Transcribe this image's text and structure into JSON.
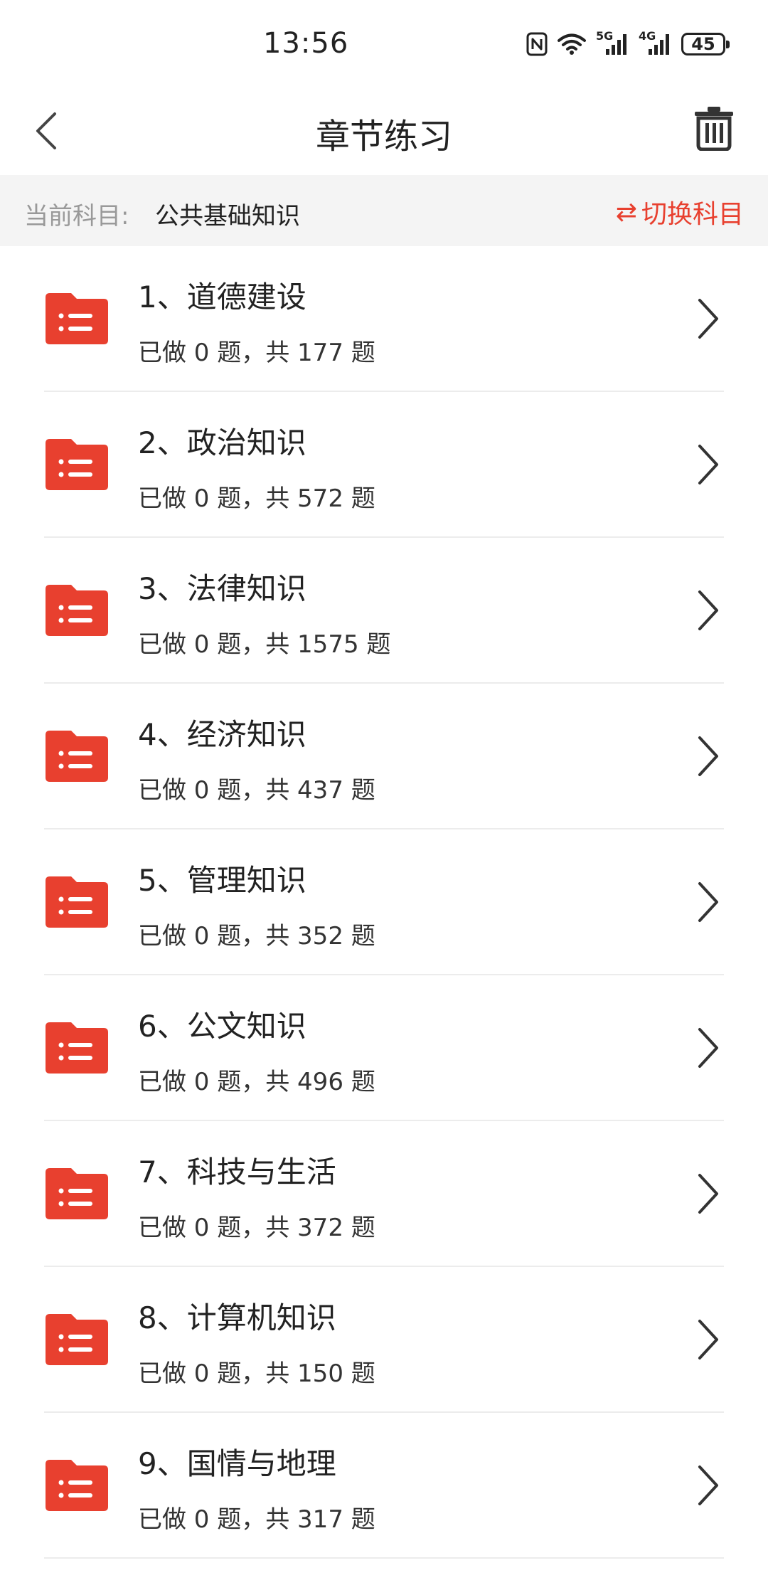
{
  "status_bar": {
    "time": "13:56",
    "battery": "45",
    "net1": "5G",
    "net2": "4G"
  },
  "header": {
    "title": "章节练习",
    "back_icon": "chevron-left-icon",
    "trash_icon": "trash-icon"
  },
  "subject": {
    "label": "当前科目:",
    "value": "公共基础知识",
    "switch_icon": "⇄",
    "switch_label": "切换科目"
  },
  "colors": {
    "accent": "#e8402f",
    "folder": "#e8402f"
  },
  "chapters": [
    {
      "title": "1、道德建设",
      "done_prefix": "已做 0 题，共 177 题"
    },
    {
      "title": "2、政治知识",
      "done_prefix": "已做 0 题，共 572 题"
    },
    {
      "title": "3、法律知识",
      "done_prefix": "已做 0 题，共 1575 题"
    },
    {
      "title": "4、经济知识",
      "done_prefix": "已做 0 题，共 437 题"
    },
    {
      "title": "5、管理知识",
      "done_prefix": "已做 0 题，共 352 题"
    },
    {
      "title": "6、公文知识",
      "done_prefix": "已做 0 题，共 496 题"
    },
    {
      "title": "7、科技与生活",
      "done_prefix": "已做 0 题，共 372 题"
    },
    {
      "title": "8、计算机知识",
      "done_prefix": "已做 0 题，共 150 题"
    },
    {
      "title": "9、国情与地理",
      "done_prefix": "已做 0 题，共 317 题"
    }
  ]
}
